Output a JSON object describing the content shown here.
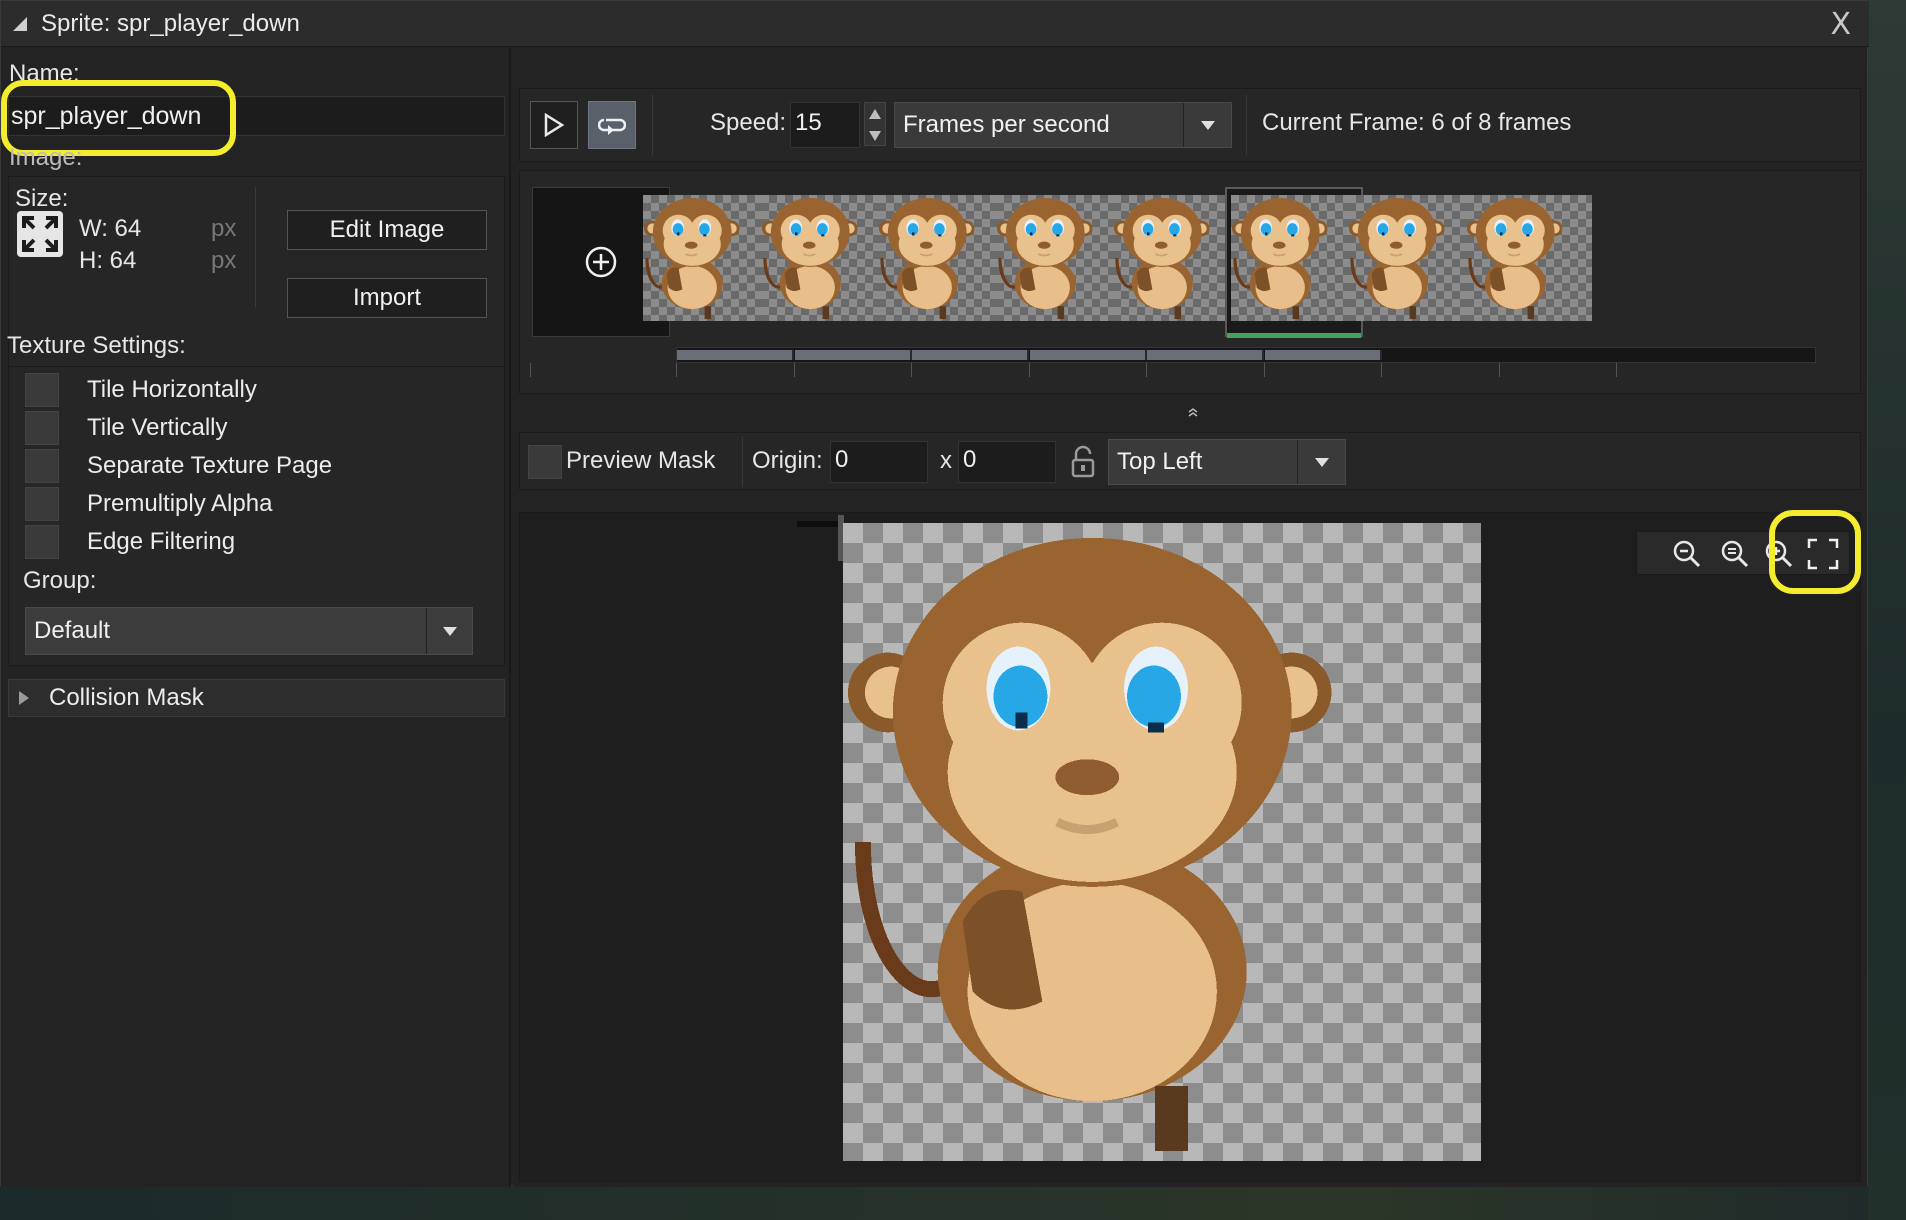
{
  "window": {
    "title": "Sprite: spr_player_down",
    "close_label": "X"
  },
  "left": {
    "name_label": "Name:",
    "name_value": "spr_player_down",
    "image_label": "Image:",
    "size_label": "Size:",
    "width_text": "W: 64",
    "height_text": "H: 64",
    "unit": "px",
    "edit_image": "Edit Image",
    "import": "Import",
    "texture_settings_label": "Texture Settings:",
    "checkboxes": [
      {
        "label": "Tile Horizontally",
        "checked": false
      },
      {
        "label": "Tile Vertically",
        "checked": false
      },
      {
        "label": "Separate Texture Page",
        "checked": false
      },
      {
        "label": "Premultiply Alpha",
        "checked": false
      },
      {
        "label": "Edge Filtering",
        "checked": false
      }
    ],
    "group_label": "Group:",
    "group_value": "Default",
    "collision_mask": "Collision Mask"
  },
  "toolbar": {
    "speed_label": "Speed:",
    "speed_value": "15",
    "speed_unit": "Frames per second",
    "current_frame": "Current Frame: 6 of 8 frames"
  },
  "frames": {
    "count": 8,
    "selected_index": 5
  },
  "origin": {
    "preview_mask": "Preview Mask",
    "origin_label": "Origin:",
    "x_value": "0",
    "x_sep": "x",
    "y_value": "0",
    "preset": "Top Left"
  },
  "colors": {
    "highlight": "#f3ec2f",
    "selected_frame_bar": "#3fa55b",
    "panel_bg": "#232323"
  }
}
